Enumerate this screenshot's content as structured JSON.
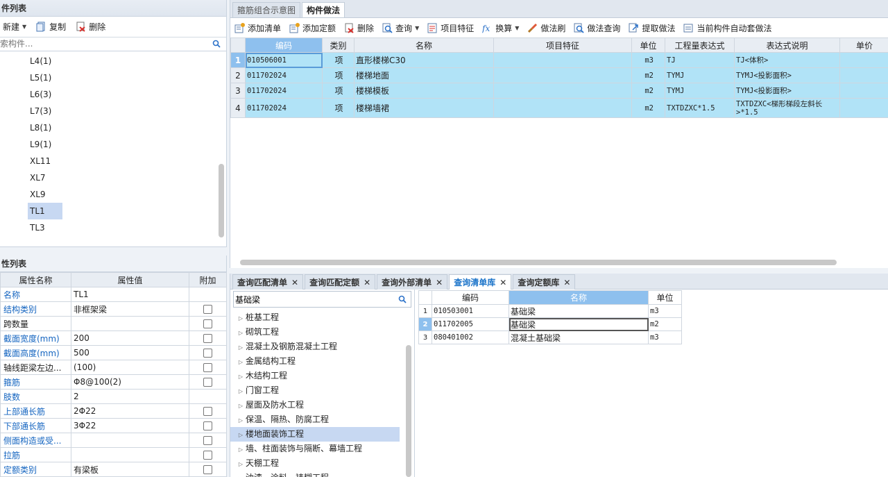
{
  "left_panel": {
    "title": "件列表",
    "toolbar": {
      "new_label": "新建",
      "copy_label": "复制",
      "delete_label": "删除"
    },
    "search": {
      "placeholder": "索构件..."
    },
    "items": [
      {
        "label": "L4(1)"
      },
      {
        "label": "L5(1)"
      },
      {
        "label": "L6(3)"
      },
      {
        "label": "L7(3)"
      },
      {
        "label": "L8(1)"
      },
      {
        "label": "L9(1)"
      },
      {
        "label": "XL11"
      },
      {
        "label": "XL7"
      },
      {
        "label": "XL9"
      },
      {
        "label": "TL1"
      },
      {
        "label": "TL3"
      }
    ],
    "selected_index": 9
  },
  "prop_panel": {
    "title": "性列表",
    "headers": {
      "name": "属性名称",
      "value": "属性值",
      "extra": "附加"
    },
    "rows": [
      {
        "name": "名称",
        "value": "TL1",
        "blue": true,
        "checkbox": false
      },
      {
        "name": "结构类别",
        "value": "非框架梁",
        "blue": true,
        "checkbox": true
      },
      {
        "name": "跨数量",
        "value": "",
        "blue": false,
        "checkbox": true
      },
      {
        "name": "截面宽度(mm)",
        "value": "200",
        "blue": true,
        "checkbox": true
      },
      {
        "name": "截面高度(mm)",
        "value": "500",
        "blue": true,
        "checkbox": true
      },
      {
        "name": "轴线距梁左边...",
        "value": "(100)",
        "blue": false,
        "checkbox": true
      },
      {
        "name": "箍筋",
        "value": "Φ8@100(2)",
        "blue": true,
        "checkbox": true
      },
      {
        "name": "肢数",
        "value": "2",
        "blue": true,
        "checkbox": false
      },
      {
        "name": "上部通长筋",
        "value": "2Φ22",
        "blue": true,
        "checkbox": true
      },
      {
        "name": "下部通长筋",
        "value": "3Φ22",
        "blue": true,
        "checkbox": true
      },
      {
        "name": "侧面构造或受...",
        "value": "",
        "blue": true,
        "checkbox": true
      },
      {
        "name": "拉筋",
        "value": "",
        "blue": true,
        "checkbox": true
      },
      {
        "name": "定额类别",
        "value": "有梁板",
        "blue": true,
        "checkbox": true
      }
    ]
  },
  "top_tabs": [
    {
      "label": "箍筋组合示意图",
      "active": false
    },
    {
      "label": "构件做法",
      "active": true
    }
  ],
  "main_toolbar": [
    {
      "label": "添加清单",
      "icon": "add-list-icon",
      "caret": false
    },
    {
      "label": "添加定额",
      "icon": "add-quota-icon",
      "caret": false
    },
    {
      "label": "删除",
      "icon": "delete-icon",
      "caret": false
    },
    {
      "label": "查询",
      "icon": "query-icon",
      "caret": true
    },
    {
      "label": "项目特征",
      "icon": "feature-icon",
      "caret": false
    },
    {
      "label": "换算",
      "icon": "fx-icon",
      "caret": true
    },
    {
      "label": "做法刷",
      "icon": "brush-icon",
      "caret": false
    },
    {
      "label": "做法查询",
      "icon": "method-query-icon",
      "caret": false
    },
    {
      "label": "提取做法",
      "icon": "extract-icon",
      "caret": false
    },
    {
      "label": "当前构件自动套做法",
      "icon": "auto-apply-icon",
      "caret": false
    }
  ],
  "main_table": {
    "headers": [
      "编码",
      "类别",
      "名称",
      "项目特征",
      "单位",
      "工程量表达式",
      "表达式说明",
      "单价"
    ],
    "rows": [
      {
        "num": "1",
        "code": "010506001",
        "type": "项",
        "name": "直形楼梯C30",
        "feature": "",
        "unit": "m3",
        "expr": "TJ",
        "desc": "TJ<体积>",
        "price": ""
      },
      {
        "num": "2",
        "code": "011702024",
        "type": "项",
        "name": "楼梯地面",
        "feature": "",
        "unit": "m2",
        "expr": "TYMJ",
        "desc": "TYMJ<投影面积>",
        "price": ""
      },
      {
        "num": "3",
        "code": "011702024",
        "type": "项",
        "name": "楼梯模板",
        "feature": "",
        "unit": "m2",
        "expr": "TYMJ",
        "desc": "TYMJ<投影面积>",
        "price": ""
      },
      {
        "num": "4",
        "code": "011702024",
        "type": "项",
        "name": "楼梯墙裙",
        "feature": "",
        "unit": "m2",
        "expr": "TXTDZXC*1.5",
        "desc": "TXTDZXC<梯形梯段左斜长>*1.5",
        "price": ""
      }
    ]
  },
  "bottom_tabs": [
    {
      "label": "查询匹配清单",
      "active": false
    },
    {
      "label": "查询匹配定额",
      "active": false
    },
    {
      "label": "查询外部清单",
      "active": false
    },
    {
      "label": "查询清单库",
      "active": true
    },
    {
      "label": "查询定额库",
      "active": false
    }
  ],
  "bottom_search": {
    "value": "基础梁"
  },
  "tree_items": [
    {
      "label": "桩基工程"
    },
    {
      "label": "砌筑工程"
    },
    {
      "label": "混凝土及钢筋混凝土工程"
    },
    {
      "label": "金属结构工程"
    },
    {
      "label": "木结构工程"
    },
    {
      "label": "门窗工程"
    },
    {
      "label": "屋面及防水工程"
    },
    {
      "label": "保温、隔热、防腐工程"
    },
    {
      "label": "楼地面装饰工程"
    },
    {
      "label": "墙、柱面装饰与隔断、幕墙工程"
    },
    {
      "label": "天棚工程"
    },
    {
      "label": "油漆、涂料、裱糊工程"
    }
  ],
  "tree_selected_index": 8,
  "result_table": {
    "headers": [
      "编码",
      "名称",
      "单位"
    ],
    "rows": [
      {
        "num": "1",
        "code": "010503001",
        "name": "基础梁",
        "unit": "m3"
      },
      {
        "num": "2",
        "code": "011702005",
        "name": "基础梁",
        "unit": "m2"
      },
      {
        "num": "3",
        "code": "080401002",
        "name": "混凝土基础梁",
        "unit": "m3"
      }
    ],
    "selected_row": 1
  },
  "colors": {
    "row_blue": "#b1e3f7",
    "header_blue": "#8ec0ee",
    "label_blue": "#1565c0",
    "selection": "#c7d8f2"
  }
}
